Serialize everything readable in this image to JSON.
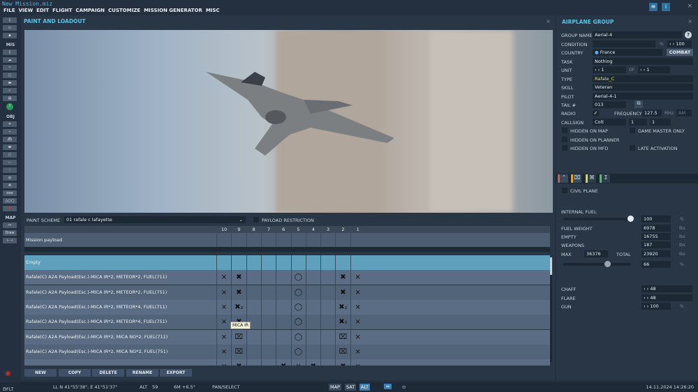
{
  "window": {
    "title": "New Mission.miz",
    "close": "×"
  },
  "menu": [
    "FILE",
    "VIEW",
    "EDIT",
    "FLIGHT",
    "CAMPAIGN",
    "CUSTOMIZE",
    "MISSION GENERATOR",
    "MISC"
  ],
  "toolbar": {
    "sections": {
      "mis": "MIS",
      "obj": "OBJ",
      "map": "MAP"
    },
    "draw": "Draw"
  },
  "main": {
    "title": "PAINT AND LOADOUT",
    "close": "×",
    "paint_scheme_label": "PAINT SCHEME",
    "paint_scheme": "01 rafale c lafayette",
    "payload_restriction": "PAYLOAD RESTRICTION",
    "stations": [
      "10",
      "9",
      "8",
      "7",
      "6",
      "5",
      "4",
      "3",
      "2",
      "1"
    ],
    "mission_payload": "Mission payload",
    "tooltip": "MICA IR",
    "payloads": [
      {
        "name": "Empty",
        "pylons": [
          "",
          "",
          "",
          "",
          "",
          "",
          "",
          "",
          "",
          ""
        ]
      },
      {
        "name": "Rafale(C) A2A Payload(Esc.)-MICA IR*2, METEOR*2, FUEL(711)",
        "pylons": [
          "⨯",
          "✖",
          "",
          "",
          "",
          "◯",
          "",
          "",
          "✖",
          "⨯"
        ]
      },
      {
        "name": "Rafale(C) A2A Payload(Esc.)-MICA IR*2, METEOR*2, FUEL(751)",
        "pylons": [
          "⨯",
          "✖",
          "",
          "",
          "",
          "◯",
          "",
          "",
          "✖",
          "⨯"
        ]
      },
      {
        "name": "Rafale(C) A2A Payload(Esc.)-MICA IR*2, METEOR*4, FUEL(711)",
        "pylons": [
          "⨯",
          "✖₂",
          "",
          "",
          "",
          "◯",
          "",
          "",
          "✖₂",
          "⨯"
        ]
      },
      {
        "name": "Rafale(C) A2A Payload(Esc.)-MICA IR*2, METEOR*4, FUEL(751)",
        "pylons": [
          "⨯",
          "✖",
          "",
          "",
          "",
          "◯",
          "",
          "",
          "✖₂",
          "⨯"
        ]
      },
      {
        "name": "Rafale(C) A2A Payload(Esc.)-MICA IR*2, MICA NG*2, FUEL(711)",
        "pylons": [
          "⨯",
          "⌧",
          "",
          "",
          "",
          "◯",
          "",
          "",
          "⌧",
          "⨯"
        ]
      },
      {
        "name": "Rafale(C) A2A Payload(Esc.)-MICA IR*2, MICA NG*2, FUEL(751)",
        "pylons": [
          "⨯",
          "⌧",
          "",
          "",
          "",
          "◯",
          "",
          "",
          "⌧",
          "⨯"
        ]
      },
      {
        "name": "",
        "pylons": [
          "⨯",
          "✖",
          "",
          "",
          "✖",
          "⨯",
          "✖",
          "",
          "✖",
          "⨯"
        ]
      }
    ],
    "buttons": [
      "NEW",
      "COPY",
      "DELETE",
      "RENAME",
      "EXPORT"
    ]
  },
  "group": {
    "title": "AIRPLANE GROUP",
    "close": "×",
    "group_name_label": "GROUP NAME",
    "group_name": "Aerial-4",
    "help": "?",
    "condition_label": "CONDITION",
    "condition_pct": "%",
    "condition": "100",
    "country_label": "COUNTRY",
    "country": "France",
    "combat": "COMBAT",
    "task_label": "TASK",
    "task": "Nothing",
    "unit_label": "UNIT",
    "unit": "1",
    "of_label": "OF",
    "of": "1",
    "type_label": "TYPE",
    "type": "Rafale_C",
    "skill_label": "SKILL",
    "skill": "Veteran",
    "pilot_label": "PILOT",
    "pilot": "Aerial-4-1",
    "tail_label": "TAIL #",
    "tail": "013",
    "radio_label": "RADIO",
    "frequency_label": "FREQUENCY",
    "frequency": "127.5",
    "mhz": "MHz",
    "modulation": "AM",
    "callsign_label": "CALLSIGN",
    "callsign": "Colt",
    "callsign_1": "1",
    "callsign_2": "1",
    "checks": [
      "HIDDEN ON MAP",
      "GAME MASTER ONLY",
      "HIDDEN ON PLANNER",
      "HIDDEN ON MFD",
      "LATE ACTIVATION"
    ],
    "civil_plane": "CIVIL PLANE",
    "internal_fuel_label": "INTERNAL FUEL",
    "internal_fuel": "100",
    "internal_fuel_fraction": 1.0,
    "fuel_weight_label": "FUEL WEIGHT",
    "fuel_weight": "6978",
    "empty_label": "EMPTY",
    "empty": "16755",
    "weapons_label": "WEAPONS",
    "weapons": "187",
    "max_label": "MAX",
    "max": "36376",
    "total_label": "TOTAL",
    "total": "23920",
    "load_pct": "66",
    "load_fraction": 0.66,
    "lbs": "lbs",
    "pct": "%",
    "chaff_label": "CHAFF",
    "chaff": "48",
    "flare_label": "FLARE",
    "flare": "48",
    "gun_label": "GUN",
    "gun": "100",
    "tab_colors": [
      "#e05050",
      "#e0a040",
      "#d8d840",
      "#50c060"
    ]
  },
  "status": {
    "profile": "DFLT",
    "ll": "LL  N 41°55'38\", E 41°51'37\"",
    "alt_label": "ALT",
    "alt": "59",
    "mag": "6M  +6.5°",
    "mode": "PAN/SELECT",
    "map": "MAP",
    "sat": "SAT",
    "alt_btn": "ALT",
    "datetime": "14.11.2024 14:26:20"
  }
}
